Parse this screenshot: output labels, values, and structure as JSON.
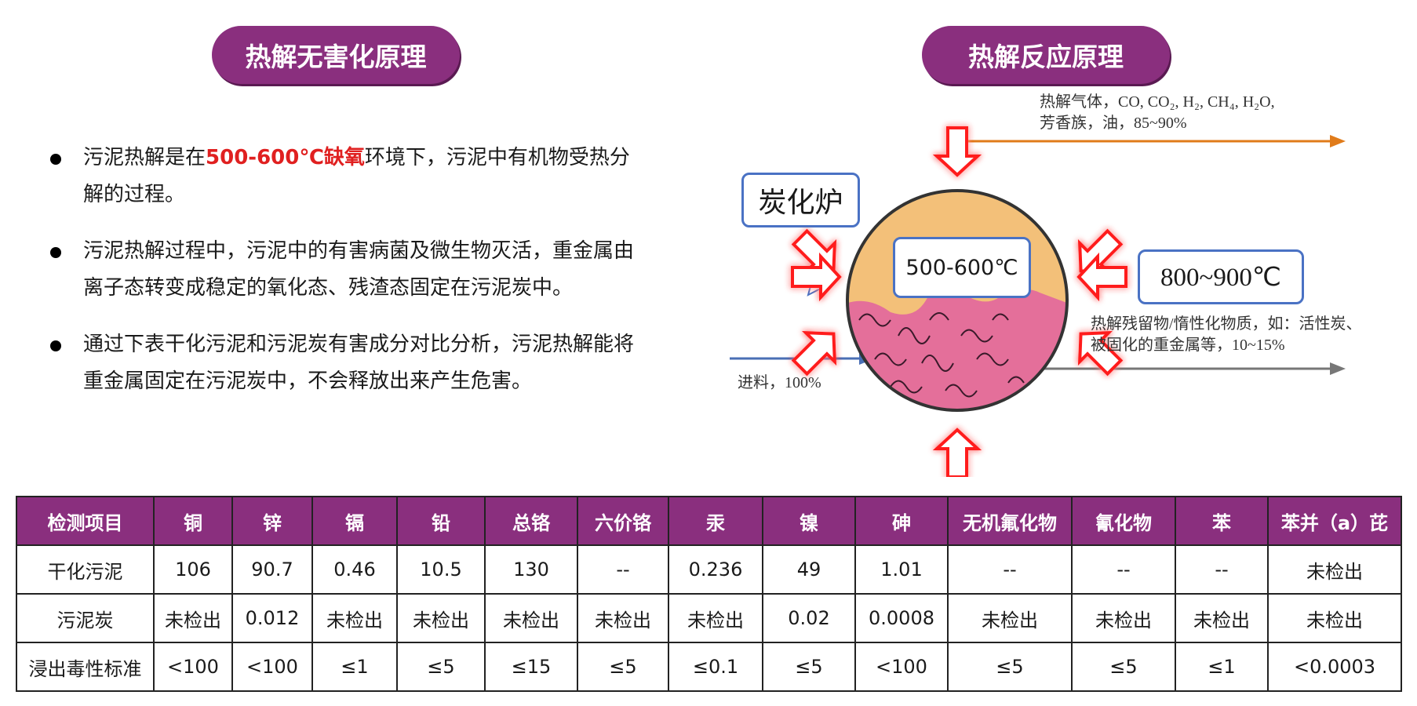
{
  "left_title": "热解无害化原理",
  "right_title": "热解反应原理",
  "bullets": [
    {
      "before": "污泥热解是在",
      "highlight": "500-600℃缺氧",
      "after": "环境下，污泥中有机物受热分解的过程。"
    },
    {
      "before": "污泥热解过程中，污泥中的有害病菌及微生物灭活，重金属由离子态转变成稳定的氧化态、残渣态固定在污泥炭中。",
      "highlight": "",
      "after": ""
    },
    {
      "before": "通过下表干化污泥和污泥炭有害成分对比分析，污泥热解能将重金属固定在污泥炭中，不会释放出来产生危害。",
      "highlight": "",
      "after": ""
    }
  ],
  "diagram": {
    "furnace_label": "炭化炉",
    "inner_temp": "500-600℃",
    "heat_temp": "800~900℃",
    "gas_line1": "热解气体，CO, CO₂, H₂, CH₄, H₂O,",
    "gas_line2": "芳香族，油，85~90%",
    "residue_line1": "热解残留物/惰性化物质，如：活性炭、",
    "residue_line2": "被固化的重金属等，10~15%",
    "feed": "进料，100%",
    "colors": {
      "arrow_red": "#ff1a1a",
      "gas_arrow": "#e07b1a",
      "residue_arrow": "#777777",
      "feed_arrow": "#4a6fb5",
      "furnace_fill": "#f3c079",
      "sludge_fill": "#e46f9a"
    }
  },
  "table": {
    "headers": [
      "检测项目",
      "铜",
      "锌",
      "镉",
      "铅",
      "总铬",
      "六价铬",
      "汞",
      "镍",
      "砷",
      "无机氟化物",
      "氰化物",
      "苯",
      "苯并（a）芘"
    ],
    "rows": [
      [
        "干化污泥",
        "106",
        "90.7",
        "0.46",
        "10.5",
        "130",
        "--",
        "0.236",
        "49",
        "1.01",
        "--",
        "--",
        "--",
        "未检出"
      ],
      [
        "污泥炭",
        "未检出",
        "0.012",
        "未检出",
        "未检出",
        "未检出",
        "未检出",
        "未检出",
        "0.02",
        "0.0008",
        "未检出",
        "未检出",
        "未检出",
        "未检出"
      ],
      [
        "浸出毒性标准",
        "<100",
        "<100",
        "≤1",
        "≤5",
        "≤15",
        "≤5",
        "≤0.1",
        "≤5",
        "<100",
        "≤5",
        "≤5",
        "≤1",
        "<0.0003"
      ]
    ]
  }
}
